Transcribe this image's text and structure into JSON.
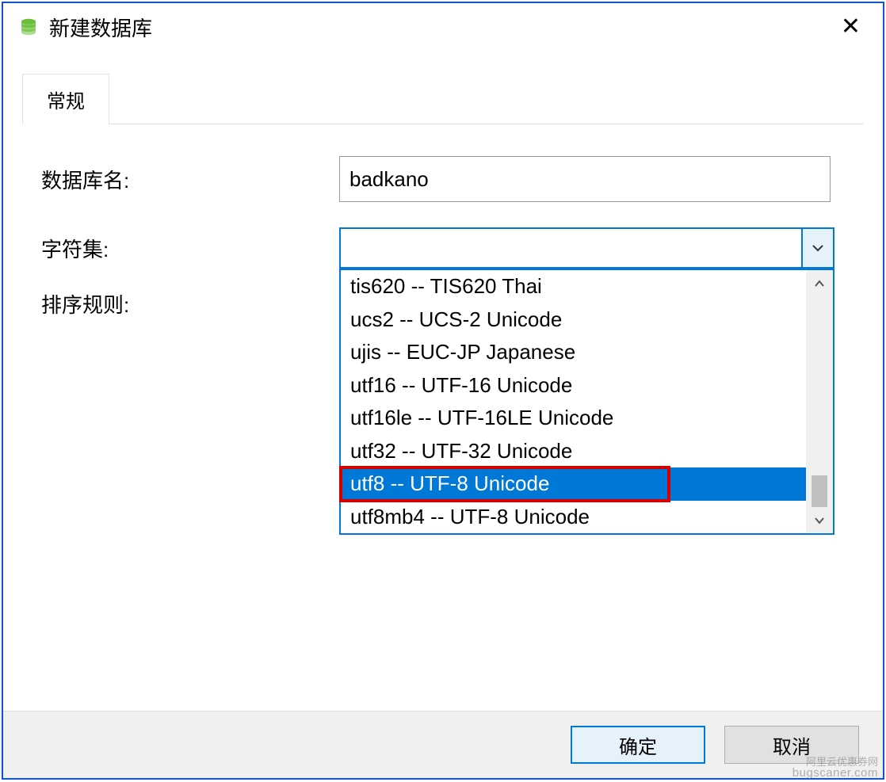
{
  "title": "新建数据库",
  "tabs": {
    "general": "常规"
  },
  "labels": {
    "db_name": "数据库名:",
    "charset": "字符集:",
    "collation": "排序规则:"
  },
  "fields": {
    "db_name_value": "badkano",
    "charset_value": ""
  },
  "dropdown": {
    "items": [
      "tis620 -- TIS620 Thai",
      "ucs2 -- UCS-2 Unicode",
      "ujis -- EUC-JP Japanese",
      "utf16 -- UTF-16 Unicode",
      "utf16le -- UTF-16LE Unicode",
      "utf32 -- UTF-32 Unicode",
      "utf8 -- UTF-8 Unicode",
      "utf8mb4 -- UTF-8 Unicode"
    ],
    "selected_index": 6
  },
  "buttons": {
    "ok": "确定",
    "cancel": "取消"
  },
  "watermark": {
    "line1": "阿里云优惠券网",
    "line2": "bugscaner.com"
  }
}
